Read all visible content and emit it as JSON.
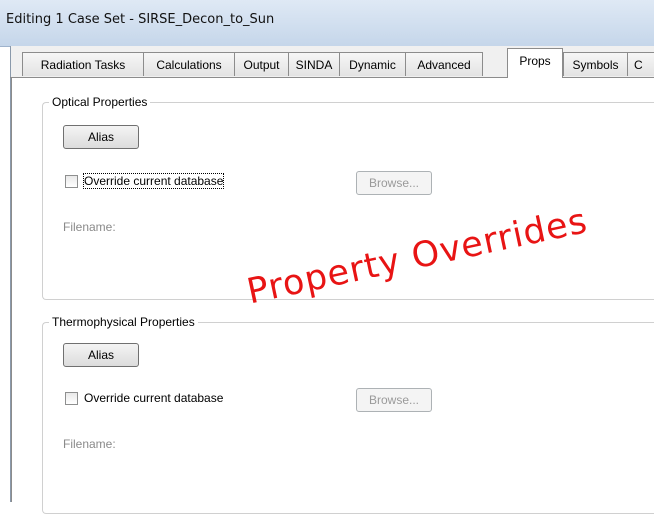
{
  "window": {
    "title": "Editing 1 Case Set - SIRSE_Decon_to_Sun"
  },
  "tabs": [
    {
      "label": "Radiation Tasks",
      "active": false
    },
    {
      "label": "Calculations",
      "active": false
    },
    {
      "label": "Output",
      "active": false
    },
    {
      "label": "SINDA",
      "active": false
    },
    {
      "label": "Dynamic",
      "active": false
    },
    {
      "label": "Advanced",
      "active": false
    },
    {
      "label": "Props",
      "active": true
    },
    {
      "label": "Symbols",
      "active": false
    },
    {
      "label": "C",
      "active": false
    }
  ],
  "optical": {
    "legend": "Optical Properties",
    "alias_label": "Alias",
    "override_label": "Override current database",
    "override_checked": false,
    "browse_label": "Browse...",
    "filename_label": "Filename:"
  },
  "thermo": {
    "legend": "Thermophysical Properties",
    "alias_label": "Alias",
    "override_label": "Override current database",
    "override_checked": false,
    "browse_label": "Browse...",
    "filename_label": "Filename:"
  },
  "annotation": {
    "text": "Property Overrides",
    "color": "#e81414"
  }
}
